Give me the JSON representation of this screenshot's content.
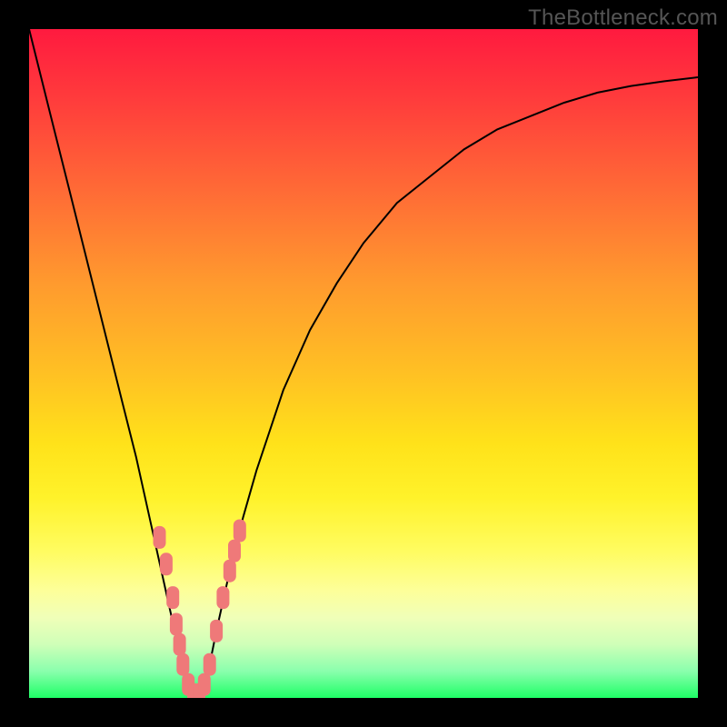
{
  "watermark": "TheBottleneck.com",
  "colors": {
    "frame": "#000000",
    "curve": "#000000",
    "marker": "#ef7979",
    "gradient_top": "#ff1a3f",
    "gradient_bottom": "#1eff66"
  },
  "chart_data": {
    "type": "line",
    "title": "",
    "xlabel": "",
    "ylabel": "",
    "xlim": [
      0,
      100
    ],
    "ylim": [
      0,
      100
    ],
    "grid": false,
    "legend": false,
    "annotations": [
      "TheBottleneck.com"
    ],
    "x": [
      0,
      2,
      4,
      6,
      8,
      10,
      12,
      14,
      16,
      18,
      20,
      22,
      23,
      24,
      25,
      26,
      27,
      28,
      30,
      32,
      34,
      36,
      38,
      42,
      46,
      50,
      55,
      60,
      65,
      70,
      75,
      80,
      85,
      90,
      95,
      100
    ],
    "y": [
      100,
      92,
      84,
      76,
      68,
      60,
      52,
      44,
      36,
      27,
      18,
      9,
      5,
      2,
      0,
      2,
      5,
      10,
      19,
      27,
      34,
      40,
      46,
      55,
      62,
      68,
      74,
      78,
      82,
      85,
      87,
      89,
      90.5,
      91.5,
      92.2,
      92.8
    ],
    "series": [
      {
        "name": "bottleneck-curve",
        "type": "line",
        "x_ref": "x",
        "y_ref": "y"
      },
      {
        "name": "highlight-markers",
        "type": "scatter",
        "points": [
          {
            "x": 19.5,
            "y": 24
          },
          {
            "x": 20.5,
            "y": 20
          },
          {
            "x": 21.5,
            "y": 15
          },
          {
            "x": 22,
            "y": 11
          },
          {
            "x": 22.5,
            "y": 8
          },
          {
            "x": 23,
            "y": 5
          },
          {
            "x": 23.8,
            "y": 2
          },
          {
            "x": 24.6,
            "y": 0.5
          },
          {
            "x": 25.4,
            "y": 0.5
          },
          {
            "x": 26.2,
            "y": 2
          },
          {
            "x": 27,
            "y": 5
          },
          {
            "x": 28,
            "y": 10
          },
          {
            "x": 29,
            "y": 15
          },
          {
            "x": 30,
            "y": 19
          },
          {
            "x": 30.7,
            "y": 22
          },
          {
            "x": 31.5,
            "y": 25
          }
        ]
      }
    ]
  }
}
